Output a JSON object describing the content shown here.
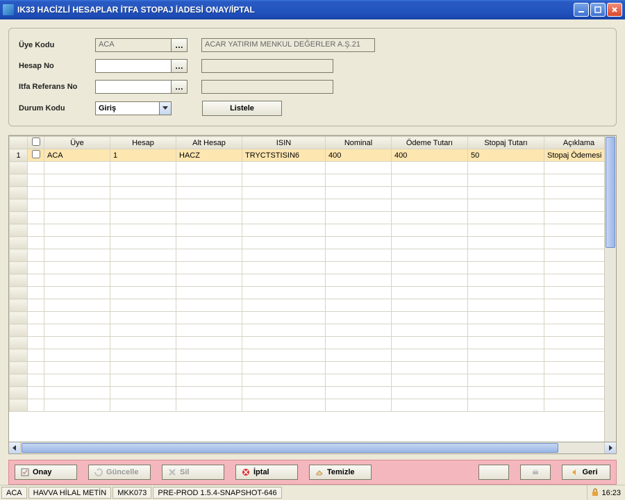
{
  "window": {
    "title": "IK33 HACİZLİ HESAPLAR İTFA STOPAJ İADESİ ONAY/İPTAL"
  },
  "form": {
    "uye_kodu_label": "Üye Kodu",
    "uye_kodu_value": "ACA",
    "uye_adi_value": "ACAR YATIRIM MENKUL DEĞERLER A.Ş.21",
    "hesap_no_label": "Hesap No",
    "hesap_no_value": "",
    "itfa_ref_label": "Itfa Referans No",
    "itfa_ref_value": "",
    "durum_kodu_label": "Durum Kodu",
    "durum_kodu_value": "Giriş",
    "listele_label": "Listele"
  },
  "grid": {
    "headers": {
      "uye": "Üye",
      "hesap": "Hesap",
      "alt_hesap": "Alt Hesap",
      "isin": "ISIN",
      "nominal": "Nominal",
      "odeme_tutari": "Ödeme Tutarı",
      "stopaj_tutari": "Stopaj Tutarı",
      "aciklama": "Açıklama"
    },
    "rows": [
      {
        "idx": "1",
        "uye": "ACA",
        "hesap": "1",
        "alt_hesap": "HACZ",
        "isin": "TRYCTSTISIN6",
        "nominal": "400",
        "odeme_tutari": "400",
        "stopaj_tutari": "50",
        "aciklama": "Stopaj Ödemesi"
      }
    ]
  },
  "actions": {
    "onay": "Onay",
    "guncelle": "Güncelle",
    "sil": "Sil",
    "iptal": "İptal",
    "temizle": "Temizle",
    "geri": "Geri"
  },
  "status": {
    "uye": "ACA",
    "user": "HAVVA HİLAL METİN",
    "terminal": "MKK073",
    "env": "PRE-PROD 1.5.4-SNAPSHOT-646",
    "time": "16:23"
  }
}
